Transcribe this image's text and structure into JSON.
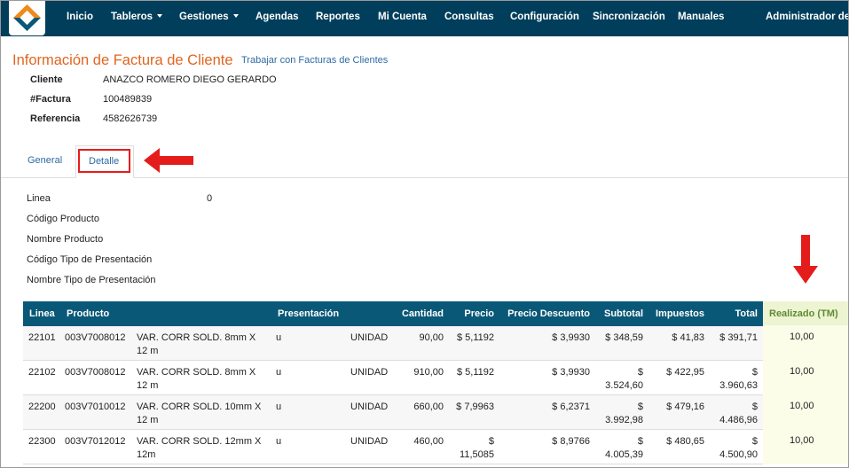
{
  "nav": {
    "items": [
      {
        "label": "Inicio",
        "dropdown": false
      },
      {
        "label": "Tableros",
        "dropdown": true
      },
      {
        "label": "Gestiones",
        "dropdown": true
      },
      {
        "label": "Agendas",
        "dropdown": false
      },
      {
        "label": "Reportes",
        "dropdown": false
      },
      {
        "label": "Mi Cuenta",
        "dropdown": false
      },
      {
        "label": "Consultas",
        "dropdown": false
      },
      {
        "label": "Configuración",
        "dropdown": false
      },
      {
        "label": "Sincronización",
        "dropdown": false
      },
      {
        "label": "Manuales",
        "dropdown": false
      }
    ],
    "user": "Administrador de",
    "bg_color": "#003e5b"
  },
  "header": {
    "title": "Información de Factura de Cliente",
    "link": "Trabajar con Facturas de Clientes",
    "title_color": "#e0651f"
  },
  "info": {
    "client_label": "Cliente",
    "client_value": "ANAZCO ROMERO DIEGO GERARDO",
    "invoice_label": "#Factura",
    "invoice_value": "100489839",
    "ref_label": "Referencia",
    "ref_value": "4582626739"
  },
  "tabs": {
    "general": "General",
    "detalle": "Detalle",
    "active": "Detalle"
  },
  "detail": {
    "linea_label": "Linea",
    "linea_value": "0",
    "codigo_label": "Código Producto",
    "nombre_label": "Nombre Producto",
    "codigo_tipo_label": "Código Tipo de Presentación",
    "nombre_tipo_label": "Nombre Tipo de Presentación"
  },
  "table": {
    "headers": {
      "linea": "Linea",
      "producto": "Producto",
      "presentacion": "Presentación",
      "cantidad": "Cantidad",
      "precio": "Precio",
      "precio_descuento": "Precio Descuento",
      "subtotal": "Subtotal",
      "impuestos": "Impuestos",
      "total": "Total",
      "realizado": "Realizado (TM)"
    },
    "rows": [
      {
        "linea": "22101",
        "codigo": "003V7008012",
        "nombre_l1": "VAR. CORR SOLD. 8mm X",
        "nombre_l2": "12 m",
        "pres_code": "u",
        "pres_name": "UNIDAD",
        "cantidad": "90,00",
        "precio_l1": "$ 5,1192",
        "precio_l2": "",
        "precio_desc": "$ 3,9930",
        "subtotal_l1": "$ 348,59",
        "subtotal_l2": "",
        "impuestos": "$ 41,83",
        "total_l1": "$ 391,71",
        "total_l2": "",
        "realizado": "10,00"
      },
      {
        "linea": "22102",
        "codigo": "003V7008012",
        "nombre_l1": "VAR. CORR SOLD. 8mm X",
        "nombre_l2": "12 m",
        "pres_code": "u",
        "pres_name": "UNIDAD",
        "cantidad": "910,00",
        "precio_l1": "$ 5,1192",
        "precio_l2": "",
        "precio_desc": "$ 3,9930",
        "subtotal_l1": "$",
        "subtotal_l2": "3.524,60",
        "impuestos": "$ 422,95",
        "total_l1": "$",
        "total_l2": "3.960,63",
        "realizado": "10,00"
      },
      {
        "linea": "22200",
        "codigo": "003V7010012",
        "nombre_l1": "VAR. CORR SOLD. 10mm X",
        "nombre_l2": "12 m",
        "pres_code": "u",
        "pres_name": "UNIDAD",
        "cantidad": "660,00",
        "precio_l1": "$ 7,9963",
        "precio_l2": "",
        "precio_desc": "$ 6,2371",
        "subtotal_l1": "$",
        "subtotal_l2": "3.992,98",
        "impuestos": "$ 479,16",
        "total_l1": "$",
        "total_l2": "4.486,96",
        "realizado": "10,00"
      },
      {
        "linea": "22300",
        "codigo": "003V7012012",
        "nombre_l1": "VAR. CORR SOLD. 12mm X",
        "nombre_l2": "12m",
        "pres_code": "u",
        "pres_name": "UNIDAD",
        "cantidad": "460,00",
        "precio_l1": "$",
        "precio_l2": "11,5085",
        "precio_desc": "$ 8,9766",
        "subtotal_l1": "$",
        "subtotal_l2": "4.005,39",
        "impuestos": "$ 480,65",
        "total_l1": "$",
        "total_l2": "4.500,90",
        "realizado": "10,00"
      }
    ],
    "header_color": "#0a5877",
    "realizado_color": "#edf4d2"
  },
  "annotations": {
    "arrow_color": "#e51c1c"
  }
}
